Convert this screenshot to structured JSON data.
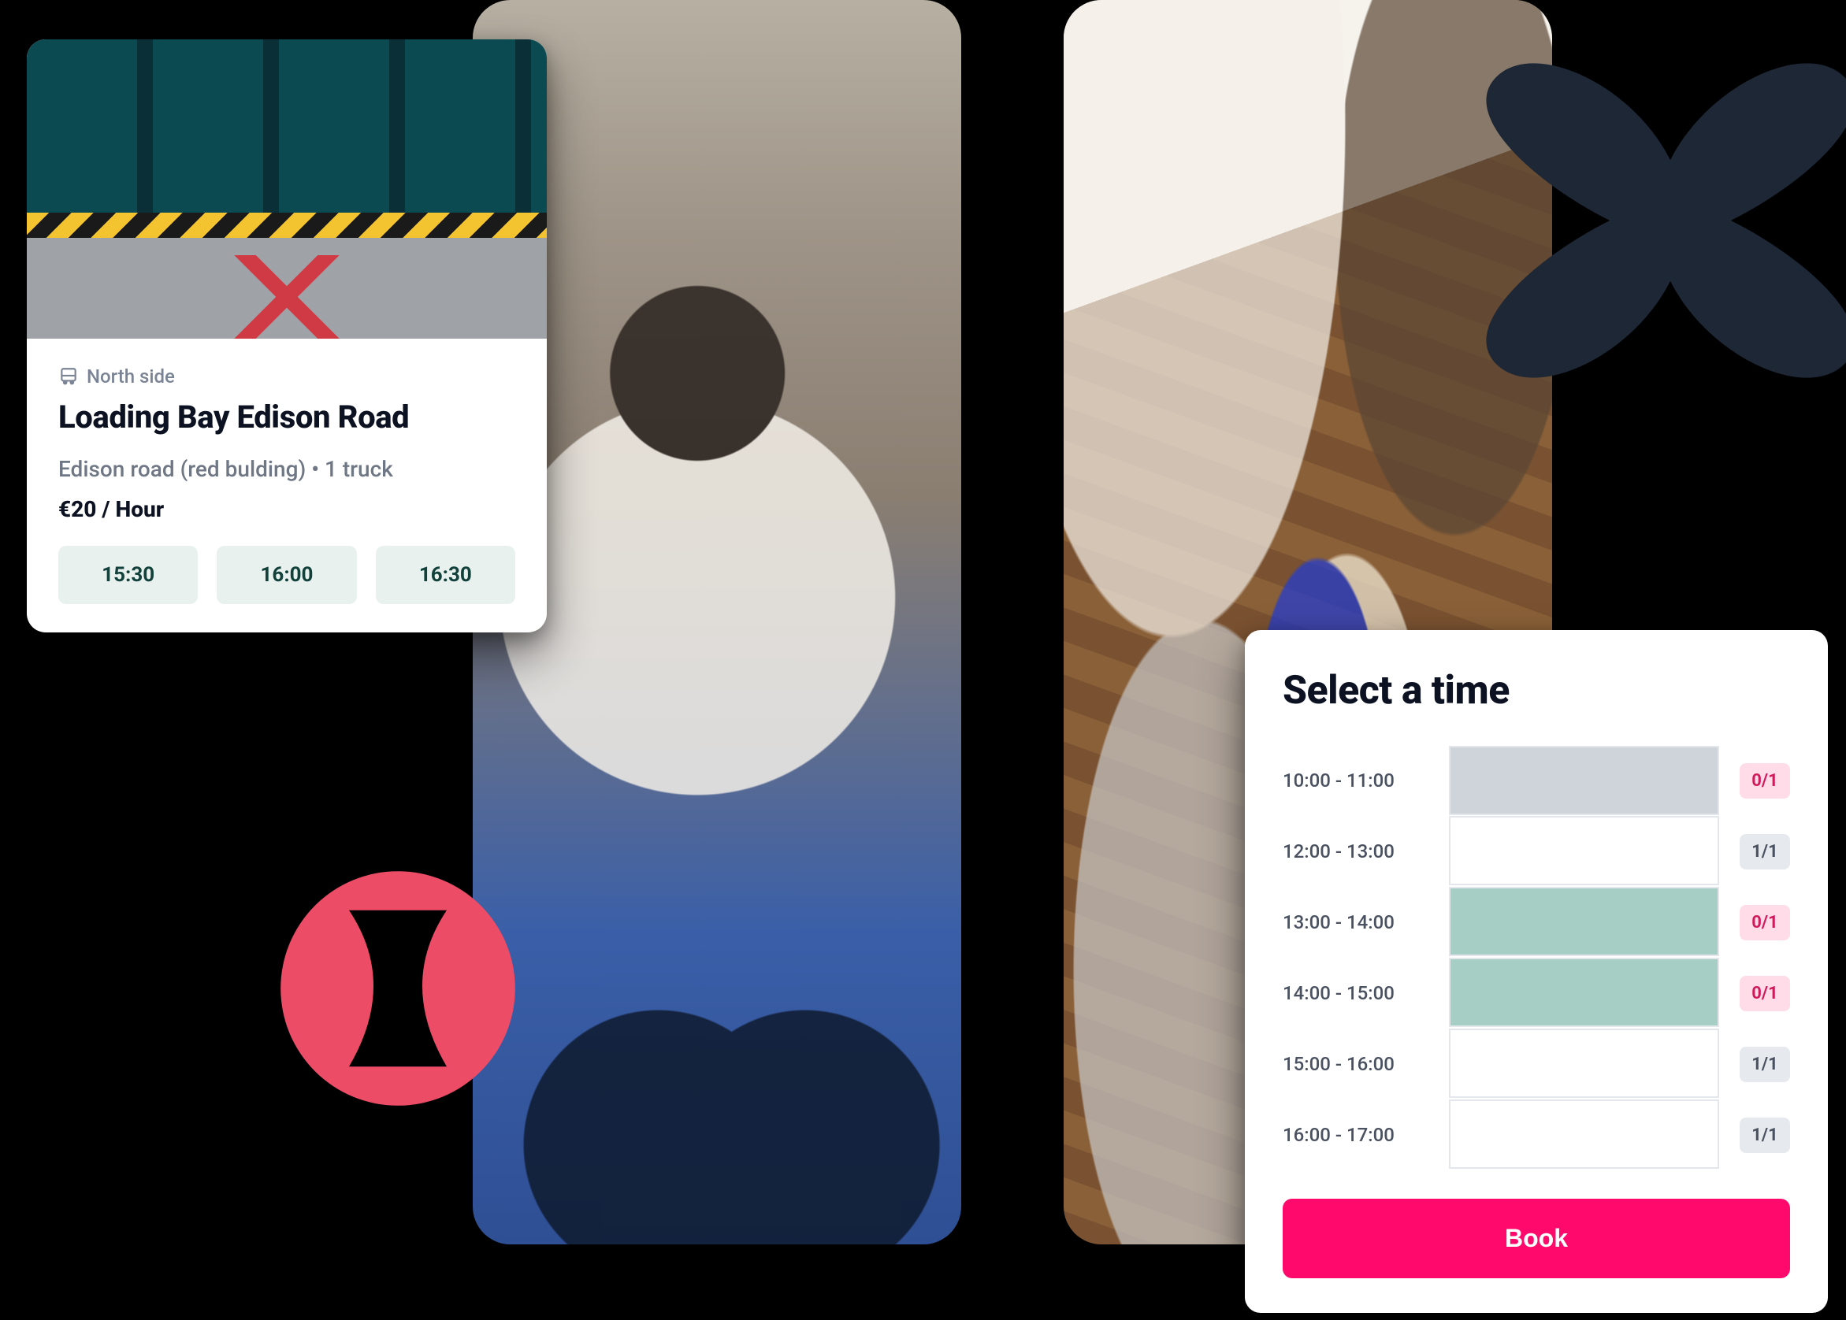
{
  "colors": {
    "accent_pink": "#ff0a6c",
    "teal_fill": "#a7cec5",
    "grey_fill": "#cfd3da",
    "badge_pink_bg": "#ffdce8",
    "badge_pink_fg": "#d11a5b",
    "badge_grey_bg": "#e6e9ed",
    "shape_dark": "#1e2735",
    "shape_red": "#ed4c67"
  },
  "listing": {
    "category_icon": "bus-icon",
    "category_label": "North side",
    "title": "Loading Bay Edison Road",
    "subtitle": "Edison road (red bulding) • 1 truck",
    "price": "€20 / Hour",
    "times": [
      "15:30",
      "16:00",
      "16:30"
    ]
  },
  "time_select": {
    "heading": "Select a time",
    "slots": [
      {
        "label": "10:00 - 11:00",
        "fill": "grey",
        "badge": "0/1",
        "badge_tone": "pink"
      },
      {
        "label": "12:00 - 13:00",
        "fill": "none",
        "badge": "1/1",
        "badge_tone": "grey"
      },
      {
        "label": "13:00 - 14:00",
        "fill": "teal",
        "badge": "0/1",
        "badge_tone": "pink"
      },
      {
        "label": "14:00 - 15:00",
        "fill": "teal",
        "badge": "0/1",
        "badge_tone": "pink"
      },
      {
        "label": "15:00 - 16:00",
        "fill": "none",
        "badge": "1/1",
        "badge_tone": "grey"
      },
      {
        "label": "16:00 - 17:00",
        "fill": "none",
        "badge": "1/1",
        "badge_tone": "grey"
      }
    ],
    "book_label": "Book"
  }
}
